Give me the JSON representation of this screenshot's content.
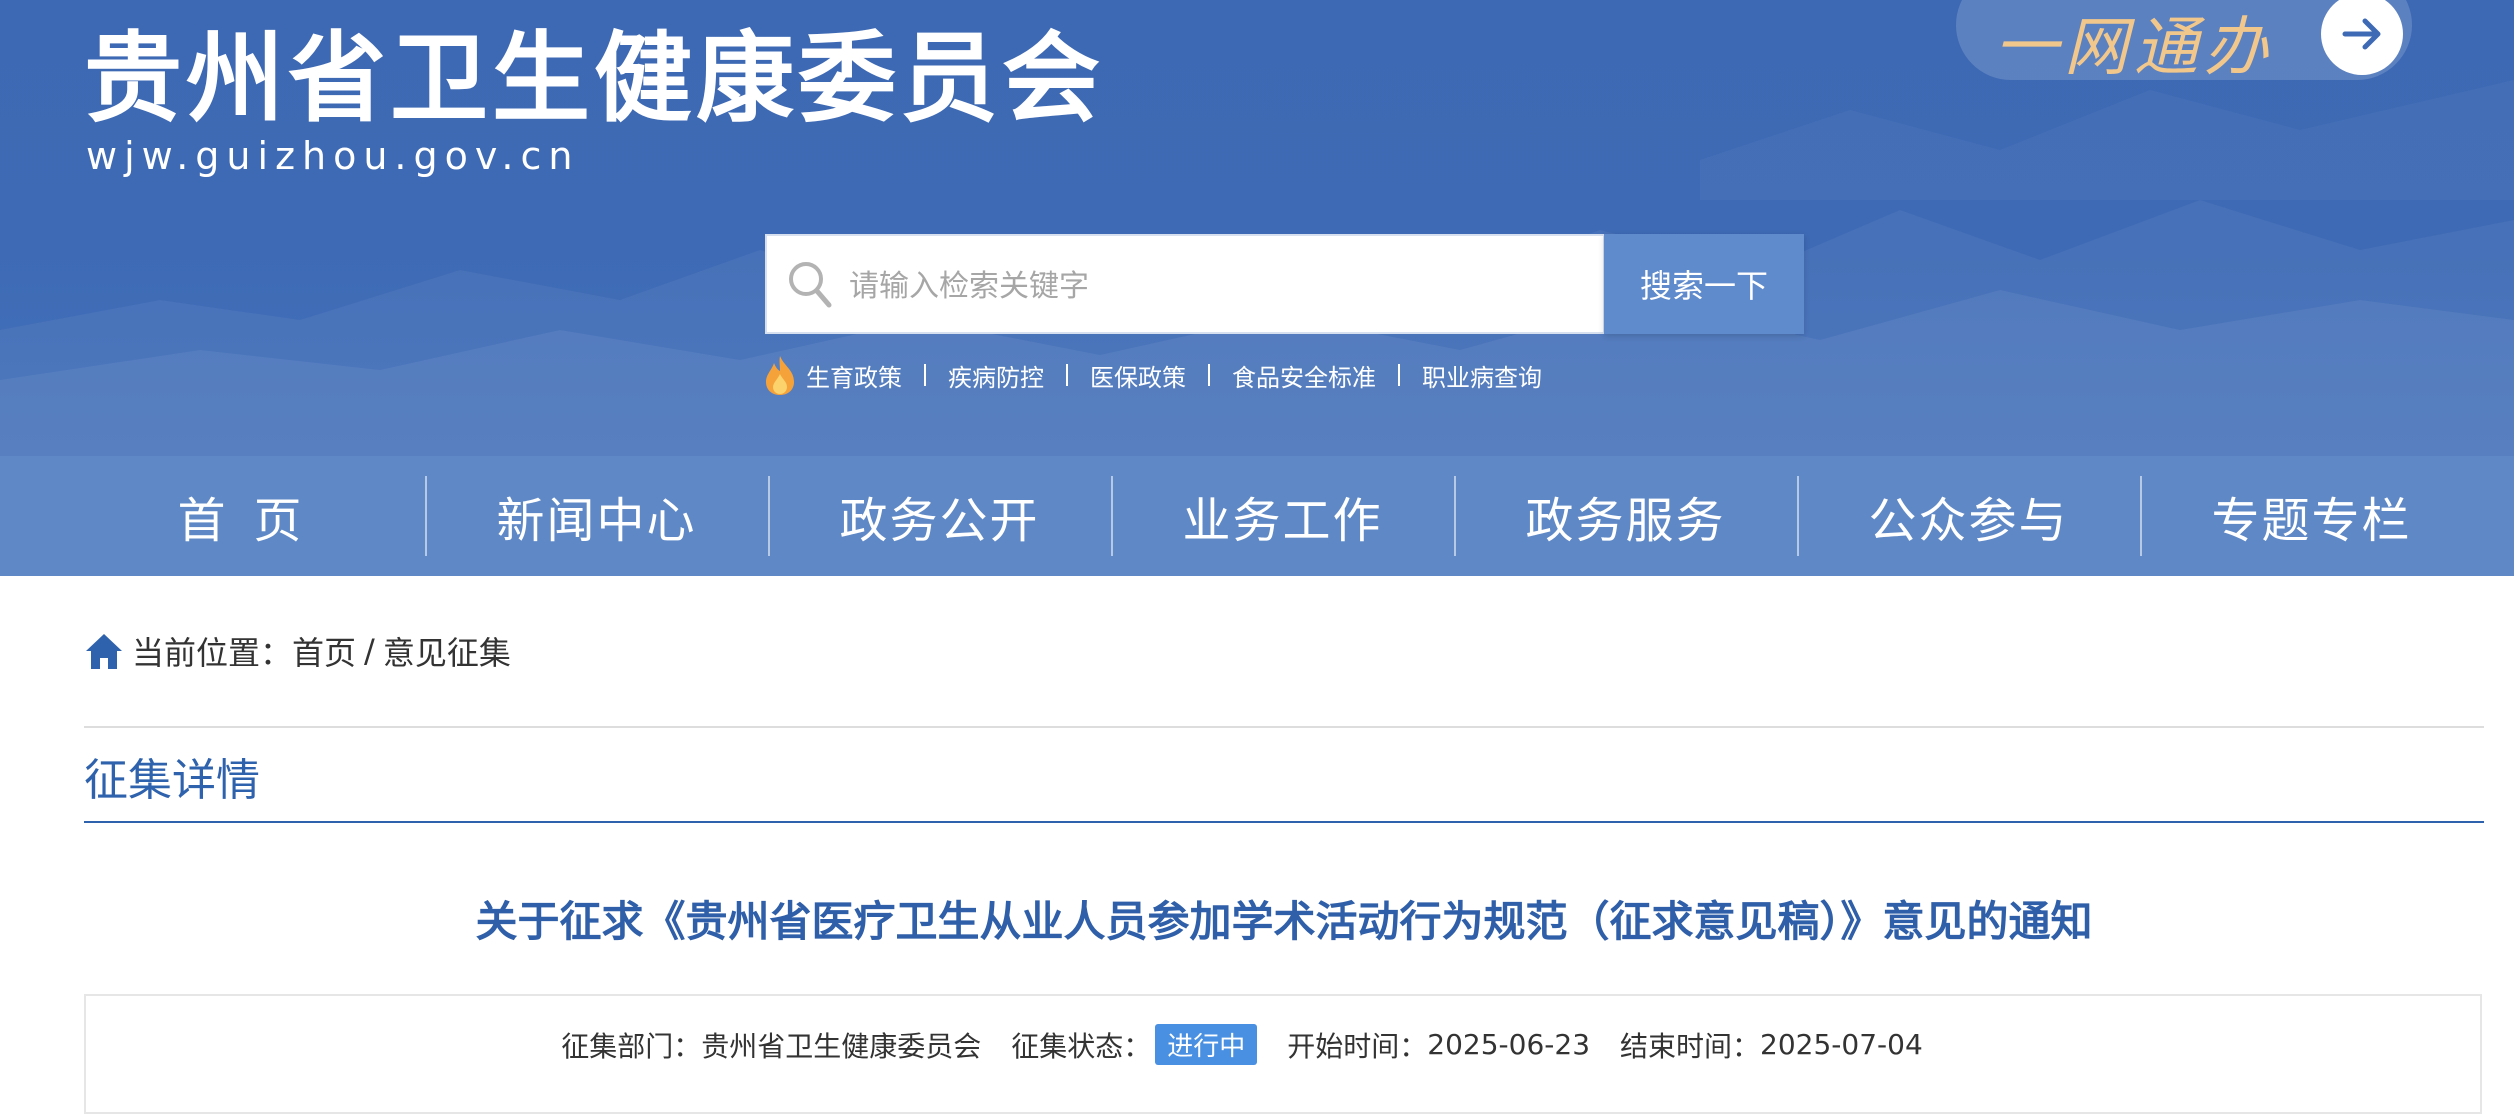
{
  "header": {
    "site_title": "贵州省卫生健康委员会",
    "site_domain": "wjw.guizhou.gov.cn",
    "ywtb_label": "一网通办",
    "colors": {
      "header_bg": "#3e6ab5",
      "nav_bg": "#5f88c6",
      "accent": "#2f62ad",
      "ywtb_text": "#f1c78c"
    }
  },
  "search": {
    "placeholder": "请输入检索关键字",
    "button_label": "搜索一下"
  },
  "hot_links": [
    "生育政策",
    "疾病防控",
    "医保政策",
    "食品安全标准",
    "职业病查询"
  ],
  "nav": {
    "items": [
      "首页",
      "新闻中心",
      "政务公开",
      "业务工作",
      "政务服务",
      "公众参与",
      "专题专栏"
    ]
  },
  "breadcrumb": {
    "label": "当前位置：",
    "home": "首页",
    "separator": "/",
    "current": "意见征集"
  },
  "section": {
    "title": "征集详情"
  },
  "notice": {
    "title": "关于征求《贵州省医疗卫生从业人员参加学术活动行为规范（征求意见稿）》意见的通知",
    "meta": {
      "dept_label": "征集部门：",
      "dept_value": "贵州省卫生健康委员会",
      "status_label": "征集状态：",
      "status_value": "进行中",
      "start_label": "开始时间：",
      "start_value": "2025-06-23",
      "end_label": "结束时间：",
      "end_value": "2025-07-04"
    }
  }
}
